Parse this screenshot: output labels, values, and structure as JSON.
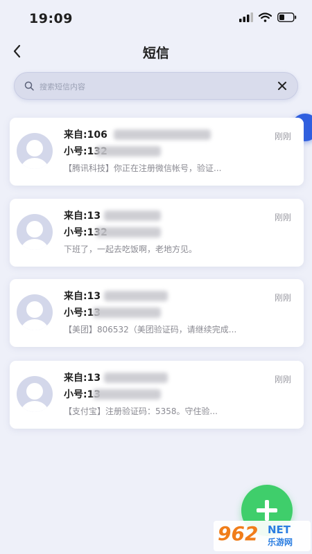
{
  "status_bar": {
    "time": "19:09",
    "icons": [
      "signal-icon",
      "wifi-icon",
      "battery-icon"
    ]
  },
  "header": {
    "title": "短信",
    "back_icon": "chevron-left-icon"
  },
  "search": {
    "placeholder": "搜索短信内容",
    "value": "",
    "clear_icon": "close-icon"
  },
  "info_badge": {
    "label": "!"
  },
  "messages": [
    {
      "from_prefix": "来自:106",
      "to_prefix": "小号:132",
      "preview": "【腾讯科技】你正在注册微信帐号，验证...",
      "time": "刚刚"
    },
    {
      "from_prefix": "来自:13",
      "to_prefix": "小号:132",
      "preview": "下班了，一起去吃饭啊，老地方见。",
      "time": "刚刚"
    },
    {
      "from_prefix": "来自:13",
      "to_prefix": "小号:13",
      "preview": "【美团】806532（美团验证码，请继续完成...",
      "time": "刚刚"
    },
    {
      "from_prefix": "来自:13",
      "to_prefix": "小号:13",
      "preview": "【支付宝】注册验证码：5358。守住验...",
      "time": "刚刚"
    }
  ],
  "fab": {
    "icon": "plus-icon"
  },
  "watermark": {
    "number": "962",
    "net": "NET",
    "cn": "乐游网"
  },
  "colors": {
    "background": "#eef0f9",
    "fab": "#3fce6b",
    "badge": "#2f5fe0"
  }
}
